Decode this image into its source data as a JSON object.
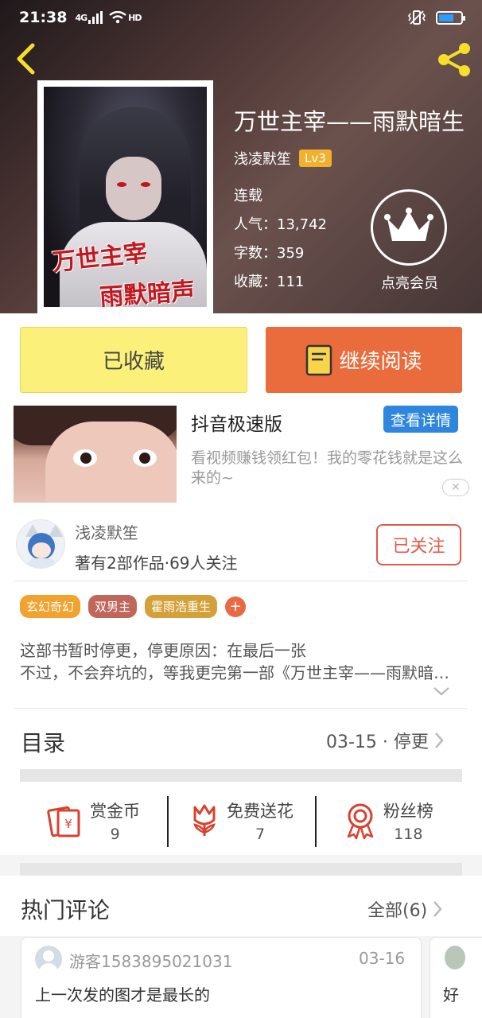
{
  "status_bar": {
    "time": "21:38",
    "network": "4G",
    "hd": "HD"
  },
  "book": {
    "title": "万世主宰——雨默暗生",
    "author": "浅凌默笙",
    "level": "Lv3",
    "status": "连载",
    "popularity": "人气：13,742",
    "word_count": "字数：359",
    "favorites": "收藏：111",
    "cover_text_line1": "万世主宰",
    "cover_text_line2": "雨默暗声"
  },
  "vip": {
    "label": "点亮会员"
  },
  "actions": {
    "favorited_label": "已收藏",
    "continue_label": "继续阅读"
  },
  "ad": {
    "title": "抖音极速版",
    "detail_label": "查看详情",
    "description": "看视频赚钱领红包！我的零花钱就是这么来的~",
    "close_label": "✕"
  },
  "author_card": {
    "name": "浅凌默笙",
    "works": "著有2部作品·69人关注",
    "follow_label": "已关注"
  },
  "tags": [
    {
      "label": "玄幻奇幻",
      "color": "#f2a32f"
    },
    {
      "label": "双男主",
      "color": "#c0665a"
    },
    {
      "label": "霍雨浩重生",
      "color": "#d4a03a"
    }
  ],
  "tag_add": "+",
  "intro": {
    "line1": "这部书暂时停更，停更原因：在最后一张",
    "line2": "不过，不会弃坑的，等我更完第一部《万世主宰——雨默暗生》"
  },
  "catalog": {
    "title": "目录",
    "update": "03-15 · 停更"
  },
  "stats": [
    {
      "label": "赏金币",
      "value": "9",
      "icon": "red-envelope-icon"
    },
    {
      "label": "免费送花",
      "value": "7",
      "icon": "flower-icon"
    },
    {
      "label": "粉丝榜",
      "value": "118",
      "icon": "medal-icon"
    }
  ],
  "comments": {
    "title": "热门评论",
    "all_label": "全部(6)",
    "items": [
      {
        "user": "游客1583895021031",
        "date": "03-16",
        "text": "上一次发的图才是最长的"
      },
      {
        "user": "",
        "date": "",
        "text": "好"
      }
    ]
  },
  "colors": {
    "accent_orange": "#ea6b3b",
    "favorite_yellow": "#fbf07a",
    "follow_red": "#e15a4a",
    "detail_blue": "#2e86de"
  }
}
